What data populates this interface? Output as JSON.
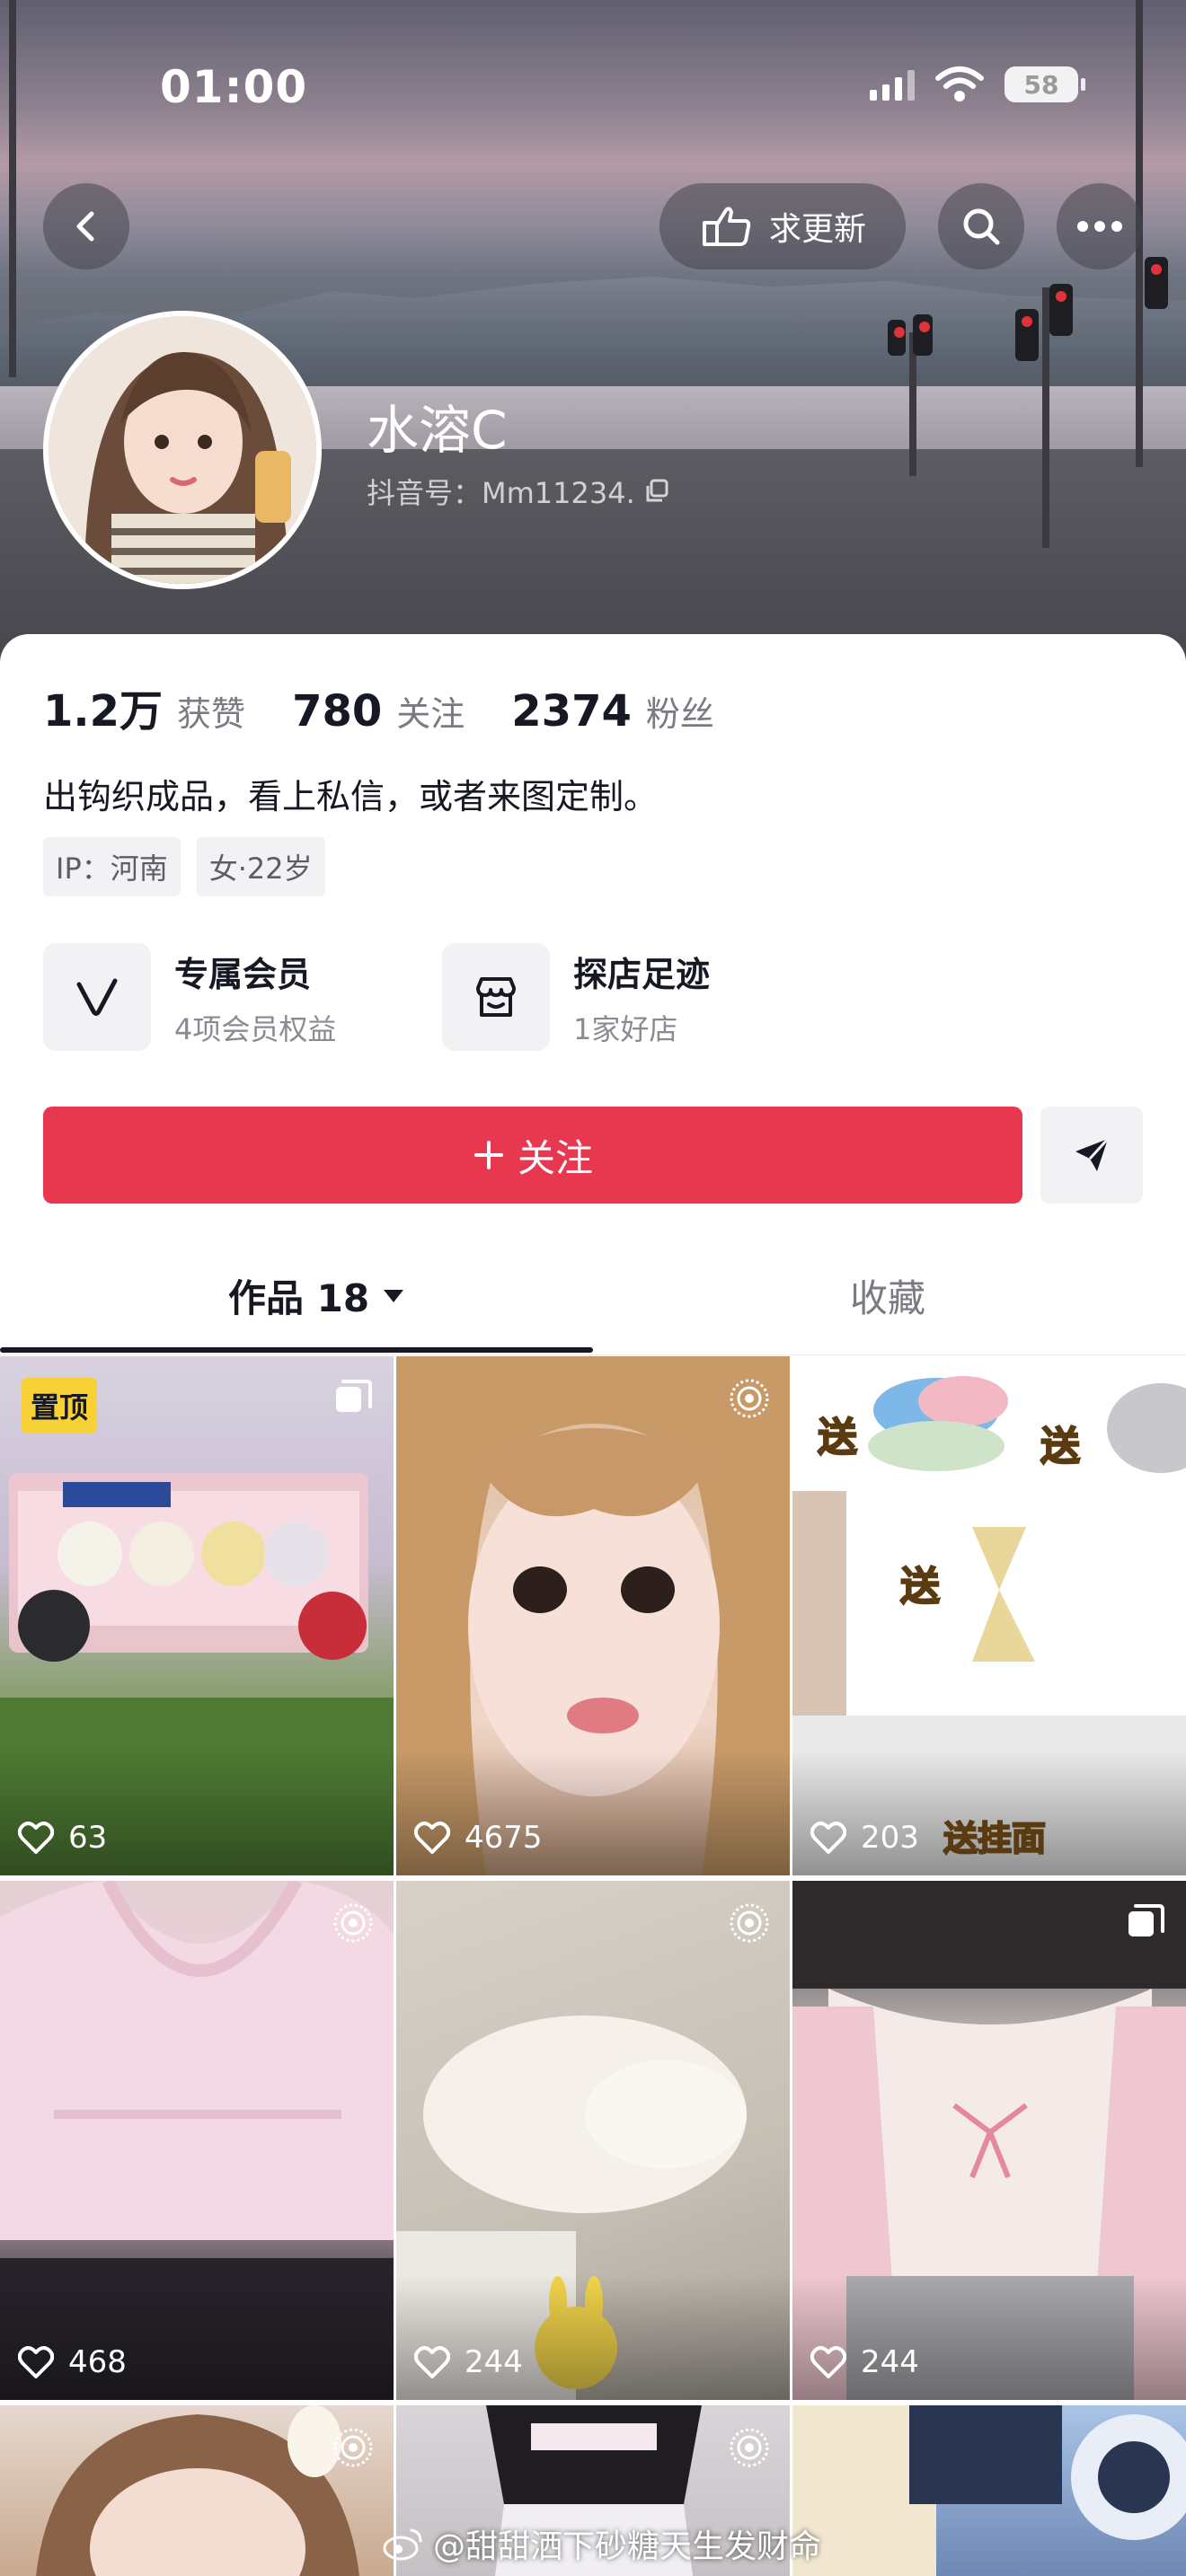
{
  "status_bar": {
    "time": "01:00",
    "battery": "58"
  },
  "header": {
    "request_update_label": "求更新"
  },
  "profile": {
    "name": "水溶C",
    "douyin_id": "抖音号：Mm11234.",
    "stats": [
      {
        "value": "1.2万",
        "label": "获赞"
      },
      {
        "value": "780",
        "label": "关注"
      },
      {
        "value": "2374",
        "label": "粉丝"
      }
    ],
    "bio": "出钩织成品，看上私信，或者来图定制。",
    "tags": [
      "IP：河南",
      "女·22岁"
    ]
  },
  "features": [
    {
      "title": "专属会员",
      "subtitle": "4项会员权益"
    },
    {
      "title": "探店足迹",
      "subtitle": "1家好店"
    }
  ],
  "actions": {
    "follow_label": "关注"
  },
  "tabs": [
    {
      "label": "作品 18"
    },
    {
      "label": "收藏"
    }
  ],
  "grid": {
    "pinned_label": "置顶",
    "items": [
      {
        "likes": "63",
        "overlay_text": ""
      },
      {
        "likes": "4675",
        "overlay_text": ""
      },
      {
        "likes": "203",
        "overlay_text": "送挂面"
      },
      {
        "likes": "468",
        "overlay_text": ""
      },
      {
        "likes": "244",
        "overlay_text": ""
      },
      {
        "likes": "244",
        "overlay_text": ""
      }
    ],
    "promo_words": [
      "送",
      "送",
      "送"
    ]
  },
  "watermark": "@甜甜洒下砂糖天生发财命"
}
